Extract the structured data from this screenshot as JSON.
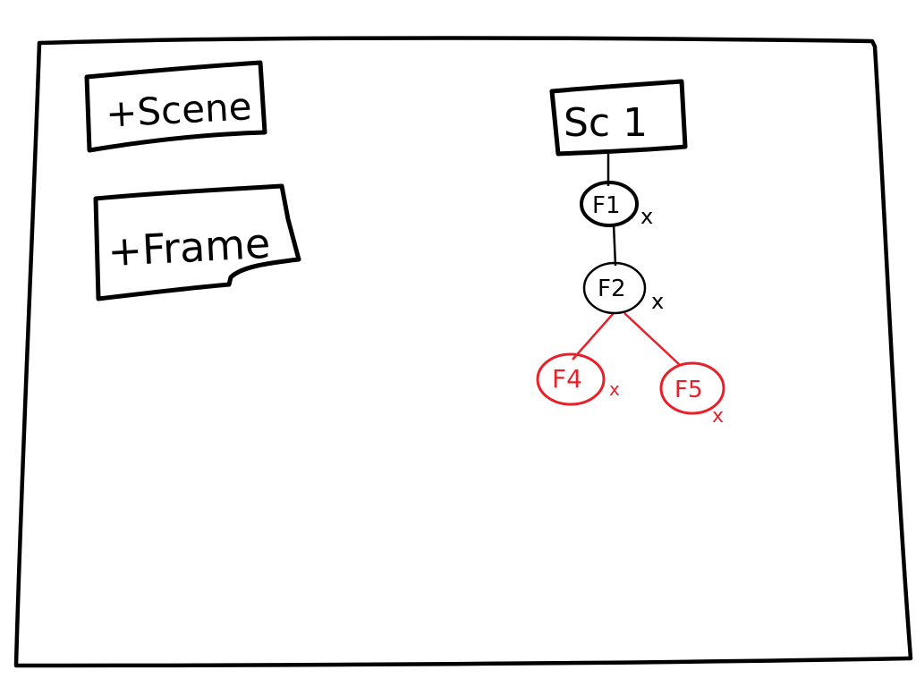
{
  "toolbar": {
    "add_scene_label": "+Scene",
    "add_frame_label": "+Frame"
  },
  "tree": {
    "scene": {
      "label": "Sc 1"
    },
    "frames": [
      {
        "label": "F1",
        "delete_label": "x",
        "selected": false
      },
      {
        "label": "F2",
        "delete_label": "x",
        "selected": false
      },
      {
        "label": "F4",
        "delete_label": "x",
        "selected": true
      },
      {
        "label": "F5",
        "delete_label": "x",
        "selected": true
      }
    ]
  },
  "colors": {
    "ink": "#000000",
    "highlight": "#e8202a",
    "paper": "#ffffff"
  }
}
